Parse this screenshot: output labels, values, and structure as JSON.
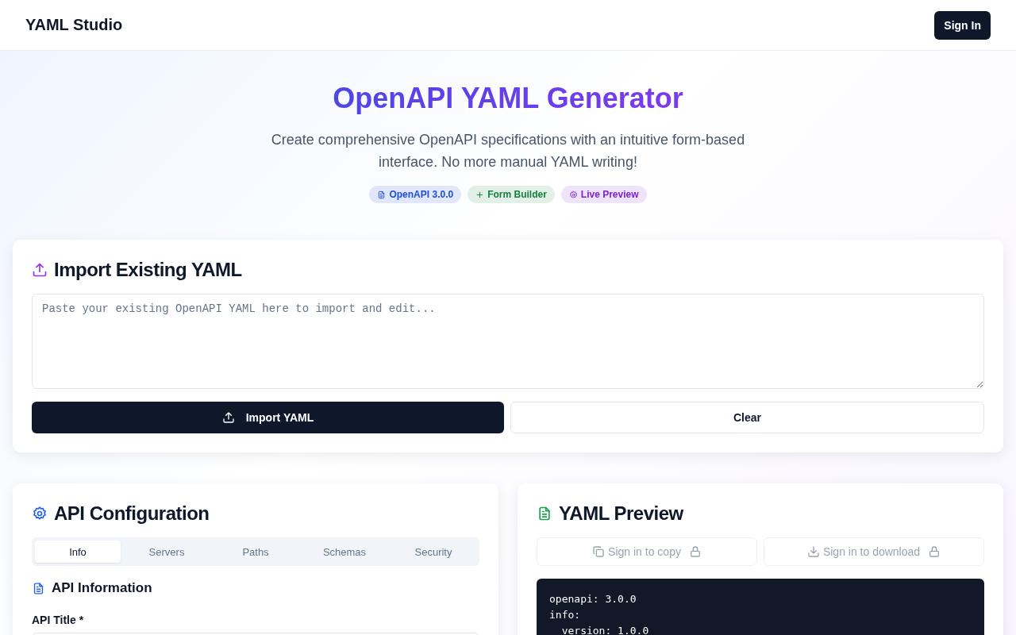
{
  "header": {
    "brand": "YAML Studio",
    "sign_in": "Sign In"
  },
  "hero": {
    "title": "OpenAPI YAML Generator",
    "subtitle": "Create comprehensive OpenAPI specifications with an intuitive form-based interface. No more manual YAML writing!",
    "badges": [
      {
        "kind": "document",
        "label": "OpenAPI 3.0.0",
        "color": "#1d4ed8"
      },
      {
        "kind": "plus",
        "label": "Form Builder",
        "color": "#15803d"
      },
      {
        "kind": "gear",
        "label": "Live Preview",
        "color": "#7e22ce"
      }
    ]
  },
  "import_card": {
    "title": "Import Existing YAML",
    "placeholder": "Paste your existing OpenAPI YAML here to import and edit...",
    "import_button": "Import YAML",
    "clear_button": "Clear"
  },
  "config_card": {
    "title": "API Configuration",
    "tabs": [
      {
        "label": "Info",
        "selected": true
      },
      {
        "label": "Servers",
        "selected": false
      },
      {
        "label": "Paths",
        "selected": false
      },
      {
        "label": "Schemas",
        "selected": false
      },
      {
        "label": "Security",
        "selected": false
      }
    ],
    "section_title": "API Information",
    "field_label": "API Title *"
  },
  "preview_card": {
    "title": "YAML Preview",
    "actions": [
      {
        "kind": "copy",
        "label": "Sign in to copy",
        "disabled": true
      },
      {
        "kind": "download",
        "label": "Sign in to download",
        "disabled": true
      }
    ],
    "code_lines": [
      "openapi: 3.0.0",
      "info:",
      "  version: 1.0.0"
    ]
  }
}
